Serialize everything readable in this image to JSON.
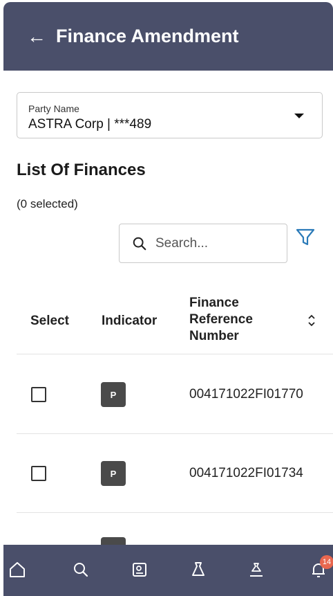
{
  "header": {
    "title": "Finance Amendment",
    "back_icon": "arrow-left-icon"
  },
  "party": {
    "label": "Party Name",
    "value": "ASTRA Corp | ***489"
  },
  "list": {
    "title": "List Of Finances",
    "selected_text": "(0 selected)"
  },
  "search": {
    "placeholder": "Search..."
  },
  "table": {
    "columns": [
      "Select",
      "Indicator",
      "Finance Reference Number"
    ],
    "rows": [
      {
        "indicator": "P",
        "reference": "004171022FI01770"
      },
      {
        "indicator": "P",
        "reference": "004171022FI01734"
      },
      {
        "indicator": "P",
        "reference": ""
      }
    ]
  },
  "bottom_nav": {
    "items": [
      "home-icon",
      "search-icon",
      "reports-icon",
      "finance-icon",
      "trade-icon",
      "notifications-icon"
    ],
    "notification_count": "14"
  },
  "colors": {
    "header": "#4a4f6a",
    "accent": "#2a7ab8",
    "badge": "#e8674f"
  }
}
